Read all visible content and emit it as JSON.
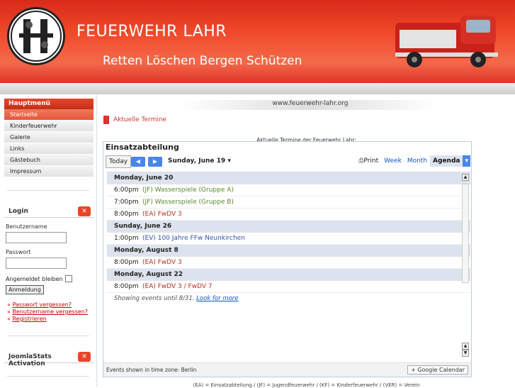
{
  "header": {
    "site_title": "FEUERWEHR LAHR",
    "slogan": "Retten Löschen Bergen Schützen"
  },
  "sidebar": {
    "menu_title": "Hauptmenü",
    "items": [
      {
        "label": "Startseite",
        "active": true
      },
      {
        "label": "Kinderfeuerwehr",
        "active": false
      },
      {
        "label": "Galerie",
        "active": false
      },
      {
        "label": "Links",
        "active": false
      },
      {
        "label": "Gästebuch",
        "active": false
      },
      {
        "label": "Impressum",
        "active": false
      }
    ],
    "login": {
      "title": "Login",
      "username_label": "Benutzername",
      "username_value": "",
      "password_label": "Passwort",
      "password_value": "",
      "remember_label": "Angemeldet bleiben",
      "submit_label": "Anmeldung",
      "links": [
        "Passwort vergessen?",
        "Benutzername vergessen?",
        "Registrieren"
      ]
    },
    "stats_title": "JoomlaStats Activation"
  },
  "main": {
    "url_text": "www.feuerwehr-lahr.org",
    "page_title": "Aktuelle Termine",
    "intro": "Aktuelle Termine der Feuerwehr Lahr:",
    "legend": "(EA) = Einsatzabteilung / (JF) = Jugendfeuerwehr / (KF) = Kinderfeuerwehr / (VER) = Verein"
  },
  "calendar": {
    "name": "Einsatzabteilung",
    "today_label": "Today",
    "prev_icon": "chevron-left",
    "next_icon": "chevron-right",
    "current_date": "Sunday, June 19",
    "views": {
      "print": "Print",
      "week": "Week",
      "month": "Month",
      "agenda": "Agenda"
    },
    "days": [
      {
        "date": "Monday, June 20",
        "events": [
          {
            "time": "6:00pm",
            "title": "(JF) Wasserspiele (Gruppe A)",
            "kind": "jf"
          },
          {
            "time": "7:00pm",
            "title": "(JF) Wasserspiele (Gruppe B)",
            "kind": "jf"
          },
          {
            "time": "8:00pm",
            "title": "(EA) FwDV 3",
            "kind": "ea"
          }
        ]
      },
      {
        "date": "Sunday, June 26",
        "events": [
          {
            "time": "1:00pm",
            "title": "(EV) 100 Jahre FFw Neunkirchen",
            "kind": "ev"
          }
        ]
      },
      {
        "date": "Monday, August 8",
        "events": [
          {
            "time": "8:00pm",
            "title": "(EA) FwDV 3",
            "kind": "ea"
          }
        ]
      },
      {
        "date": "Monday, August 22",
        "events": [
          {
            "time": "8:00pm",
            "title": "(EA) FwDV 3 / FwDV 7",
            "kind": "ea"
          }
        ]
      }
    ],
    "showing_text": "Showing events until 8/31.",
    "look_more": "Look for more",
    "timezone": "Events shown in time zone: Berlin",
    "gcal_label": "Google Calendar"
  }
}
